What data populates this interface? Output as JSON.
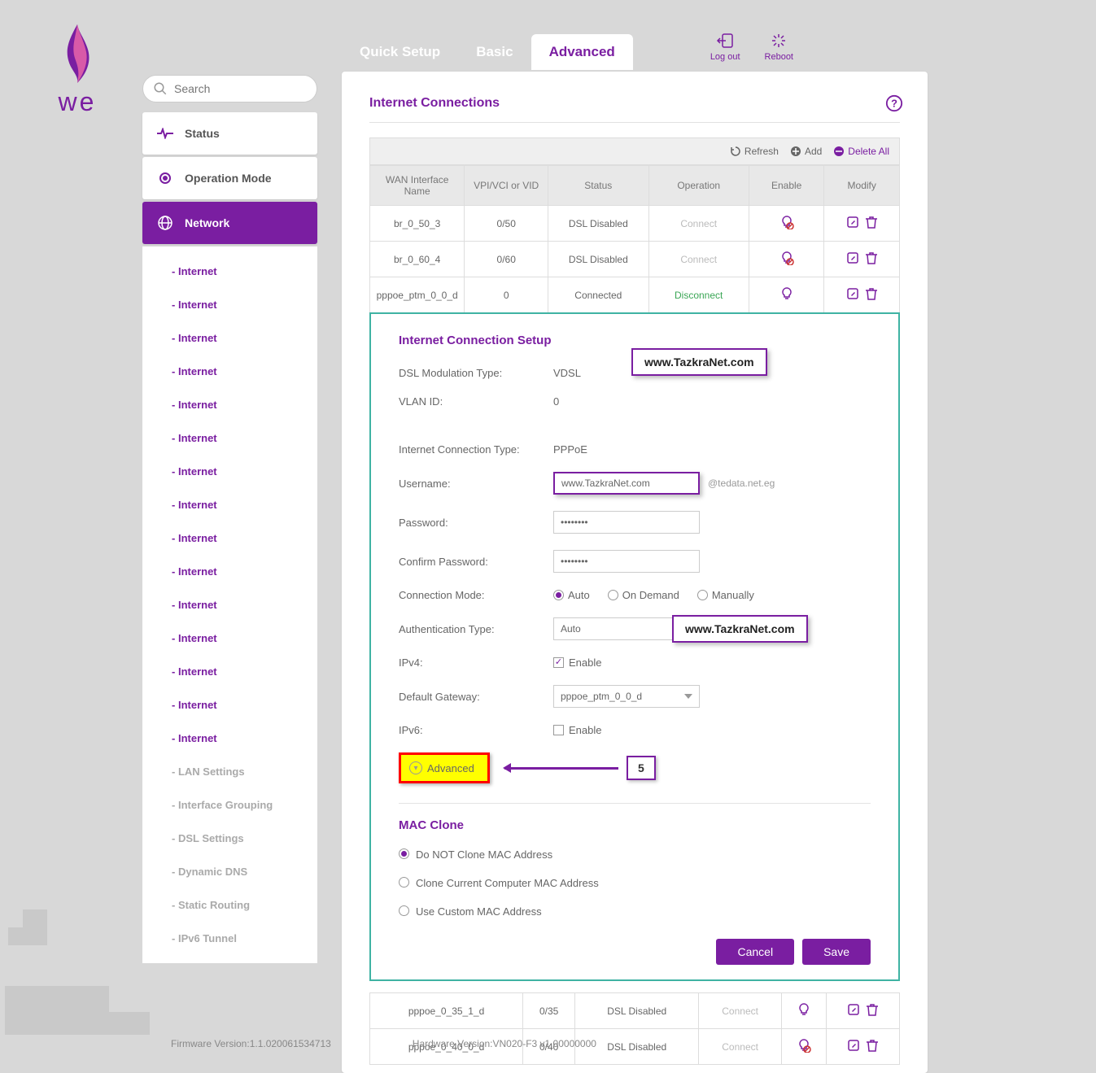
{
  "logo_text": "we",
  "search": {
    "placeholder": "Search"
  },
  "top_tabs": {
    "quick": "Quick Setup",
    "basic": "Basic",
    "advanced": "Advanced"
  },
  "top_actions": {
    "logout": "Log out",
    "reboot": "Reboot"
  },
  "nav": {
    "status": "Status",
    "opmode": "Operation Mode",
    "network": "Network",
    "sub_internet": "Internet",
    "lan": "LAN Settings",
    "ifgroup": "Interface Grouping",
    "dsl": "DSL Settings",
    "ddns": "Dynamic DNS",
    "static_routing": "Static Routing",
    "ipv6_tunnel": "IPv6 Tunnel"
  },
  "panel": {
    "title": "Internet Connections",
    "ops": {
      "refresh": "Refresh",
      "add": "Add",
      "deleteall": "Delete All"
    }
  },
  "table": {
    "headers": {
      "name": "WAN Interface Name",
      "vpi": "VPI/VCI or VID",
      "status": "Status",
      "op": "Operation",
      "enable": "Enable",
      "modify": "Modify"
    },
    "rows": [
      {
        "name": "br_0_50_3",
        "vpi": "0/50",
        "status": "DSL Disabled",
        "op": "Connect",
        "op_type": "connect",
        "bulb_off": true
      },
      {
        "name": "br_0_60_4",
        "vpi": "0/60",
        "status": "DSL Disabled",
        "op": "Connect",
        "op_type": "connect",
        "bulb_off": true
      },
      {
        "name": "pppoe_ptm_0_0_d",
        "vpi": "0",
        "status": "Connected",
        "op": "Disconnect",
        "op_type": "disconnect",
        "bulb_off": false
      }
    ],
    "rows2": [
      {
        "name": "pppoe_0_35_1_d",
        "vpi": "0/35",
        "status": "DSL Disabled",
        "op": "Connect",
        "bulb_off": false
      },
      {
        "name": "pppoe_0_40_0_d",
        "vpi": "0/40",
        "status": "DSL Disabled",
        "op": "Connect",
        "bulb_off": true
      }
    ]
  },
  "form": {
    "setup_title": "Internet Connection Setup",
    "dsl_mod_label": "DSL Modulation Type:",
    "dsl_mod_val": "VDSL",
    "vlan_label": "VLAN ID:",
    "vlan_val": "0",
    "conn_type_label": "Internet Connection Type:",
    "conn_type_val": "PPPoE",
    "user_label": "Username:",
    "user_suffix": "@tedata.net.eg",
    "pass_label": "Password:",
    "pass_val": "········",
    "cpass_label": "Confirm Password:",
    "cpass_val": "········",
    "cmode_label": "Connection Mode:",
    "cmode_opts": {
      "auto": "Auto",
      "ondemand": "On Demand",
      "manual": "Manually"
    },
    "auth_label": "Authentication Type:",
    "auth_val": "Auto",
    "ipv4_label": "IPv4:",
    "enable_txt": "Enable",
    "gw_label": "Default Gateway:",
    "gw_val": "pppoe_ptm_0_0_d",
    "ipv6_label": "IPv6:",
    "adv_toggle": "Advanced",
    "step_num": "5",
    "mac_title": "MAC Clone",
    "mac_opts": {
      "noclone": "Do NOT Clone MAC Address",
      "clonecur": "Clone Current Computer MAC Address",
      "custom": "Use Custom MAC Address"
    },
    "cancel": "Cancel",
    "save": "Save"
  },
  "watermark": "www.TazkraNet.com",
  "footer": {
    "fw": "Firmware Version:1.1.020061534713",
    "hw": "Hardware Version:VN020-F3 v1.00000000"
  }
}
